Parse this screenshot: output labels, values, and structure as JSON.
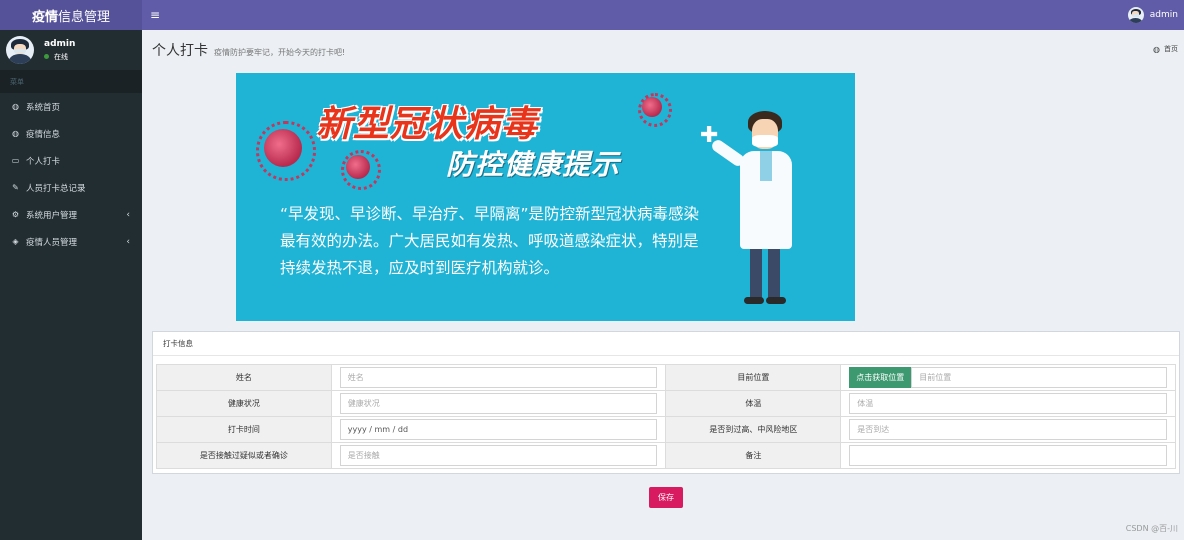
{
  "header": {
    "logo_bold": "疫情",
    "logo_rest": "信息管理",
    "menu_icon": "hamburger-icon",
    "user_name": "admin"
  },
  "sidebar": {
    "user_name": "admin",
    "status": "在线",
    "section_header": "菜单",
    "items": [
      {
        "label": "系统首页",
        "icon": "dashboard-icon"
      },
      {
        "label": "疫情信息",
        "icon": "dashboard-icon"
      },
      {
        "label": "个人打卡",
        "icon": "laptop-icon"
      },
      {
        "label": "人员打卡总记录",
        "icon": "edit-icon"
      },
      {
        "label": "系统用户管理",
        "icon": "cogs-icon"
      },
      {
        "label": "疫情人员管理",
        "icon": "cube-icon"
      }
    ]
  },
  "page": {
    "title": "个人打卡",
    "subtitle": "疫情防护要牢记，开始今天的打卡吧!",
    "breadcrumb": "首页"
  },
  "banner": {
    "title1": "新型冠状病毒",
    "title2": "防控健康提示",
    "text": "“早发现、早诊断、早治疗、早隔离”是防控新型冠状病毒感染最有效的办法。广大居民如有发热、呼吸道感染症状，特别是持续发热不退，应及时到医疗机构就诊。"
  },
  "form": {
    "box_title": "打卡信息",
    "name_label": "姓名",
    "name_placeholder": "姓名",
    "location_label": "目前位置",
    "location_button": "点击获取位置",
    "location_placeholder": "目前位置",
    "health_label": "健康状况",
    "health_placeholder": "健康状况",
    "temp_label": "体温",
    "temp_placeholder": "体温",
    "time_label": "打卡时间",
    "time_value": "yyyy / mm / dd",
    "risk_label": "是否到过高、中风险地区",
    "risk_placeholder": "是否到达",
    "contact_label": "是否接触过疑似或者确诊",
    "contact_placeholder": "是否接触",
    "note_label": "备注",
    "note_placeholder": "",
    "save_label": "保存"
  },
  "watermark": "CSDN @百-川"
}
